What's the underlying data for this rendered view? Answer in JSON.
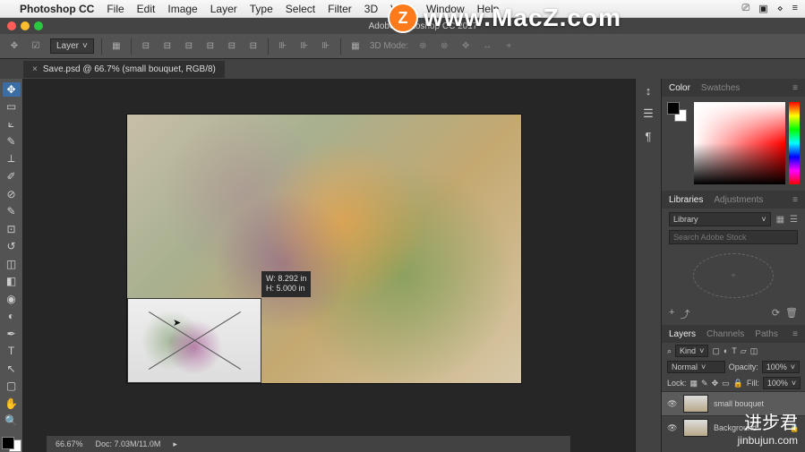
{
  "menubar": {
    "apple": "",
    "app": "Photoshop CC",
    "items": [
      "File",
      "Edit",
      "Image",
      "Layer",
      "Type",
      "Select",
      "Filter",
      "3D",
      "View",
      "Window",
      "Help"
    ],
    "right_icons": [
      "screen-icon",
      "shape-icon",
      "wifi-icon",
      "battery-icon"
    ]
  },
  "titlebar": {
    "title": "Adobe Photoshop CC 2017"
  },
  "options": {
    "layer_label": "Layer",
    "mode_label": "3D Mode:"
  },
  "tab": {
    "label": "Save.psd @ 66.7% (small bouquet, RGB/8)"
  },
  "measurement": {
    "w": "W: 8.292 in",
    "h": "H: 5.000 in"
  },
  "statusbar": {
    "zoom": "66.67%",
    "doc": "Doc: 7.03M/11.0M"
  },
  "panels": {
    "color": {
      "tabs": [
        "Color",
        "Swatches"
      ]
    },
    "libraries": {
      "tabs": [
        "Libraries",
        "Adjustments"
      ],
      "selector": "Library",
      "search_placeholder": "Search Adobe Stock",
      "plus": "+"
    },
    "layers": {
      "tabs": [
        "Layers",
        "Channels",
        "Paths"
      ],
      "filter": "Kind",
      "blend": "Normal",
      "opacity_label": "Opacity:",
      "opacity_val": "100%",
      "lock_label": "Lock:",
      "fill_label": "Fill:",
      "fill_val": "100%",
      "items": [
        {
          "name": "small bouquet",
          "active": true
        },
        {
          "name": "Background",
          "active": false
        }
      ]
    }
  },
  "watermark1": {
    "badge": "Z",
    "text": "www.MacZ.com"
  },
  "watermark2": {
    "line1": "进步君",
    "line2": "jinbujun.com"
  }
}
